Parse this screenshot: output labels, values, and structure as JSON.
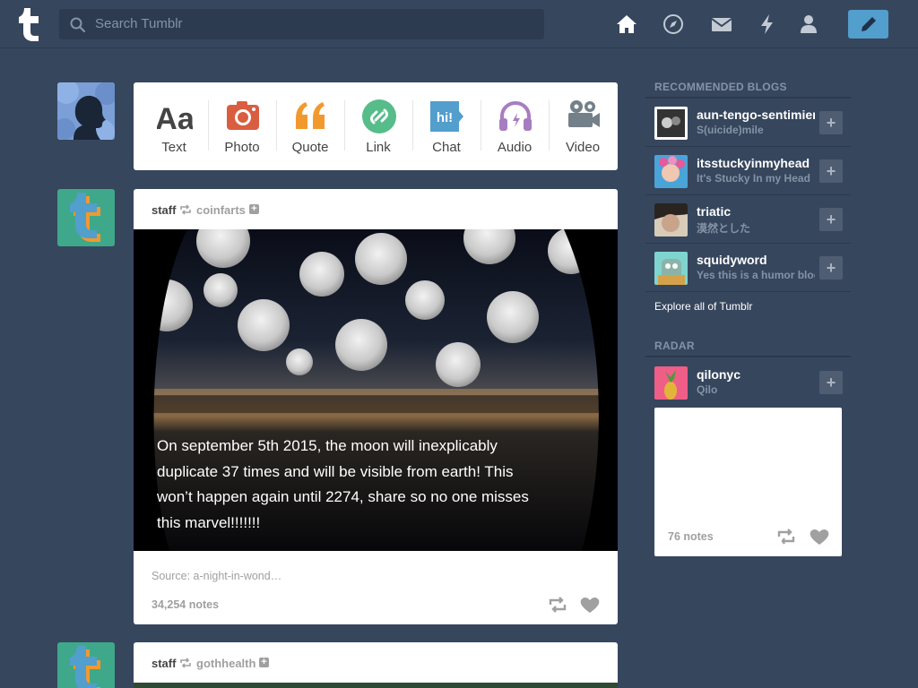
{
  "header": {
    "search_placeholder": "Search Tumblr"
  },
  "post_types": [
    {
      "label": "Text",
      "icon": "text-icon",
      "color": "#444444"
    },
    {
      "label": "Photo",
      "icon": "camera-icon",
      "color": "#d95e40"
    },
    {
      "label": "Quote",
      "icon": "quote-icon",
      "color": "#f2992e"
    },
    {
      "label": "Link",
      "icon": "link-icon",
      "color": "#56bc8a"
    },
    {
      "label": "Chat",
      "icon": "chat-icon",
      "color": "#529ecc"
    },
    {
      "label": "Audio",
      "icon": "headphones-icon",
      "color": "#a77dc2"
    },
    {
      "label": "Video",
      "icon": "video-camera-icon",
      "color": "#748089"
    }
  ],
  "posts": [
    {
      "author": "staff",
      "reblogged_from": "coinfarts",
      "caption": "On september 5th 2015, the moon will inexplicably duplicate 37 times and will be visible from earth! This won’t happen again until 2274, share so no one misses this marvel!!!!!!!",
      "source": "Source: a-night-in-wond…",
      "notes": "34,254 notes"
    },
    {
      "author": "staff",
      "reblogged_from": "gothhealth"
    }
  ],
  "sidebar": {
    "recommended_title": "RECOMMENDED BLOGS",
    "recommended": [
      {
        "name": "aun-tengo-sentimientos",
        "subtitle": "S(uicide)mile"
      },
      {
        "name": "itsstuckyinmyhead",
        "subtitle": "It's Stucky In my Head"
      },
      {
        "name": "triatic",
        "subtitle": "漠然とした"
      },
      {
        "name": "squidyword",
        "subtitle": "Yes this is a humor blog"
      }
    ],
    "explore": "Explore all of Tumblr",
    "radar_title": "RADAR",
    "radar_blog": {
      "name": "qilonyc",
      "subtitle": "Qilo"
    },
    "radar_notes": "76 notes"
  },
  "colors": {
    "background": "#36465d",
    "accent": "#529ecc"
  }
}
